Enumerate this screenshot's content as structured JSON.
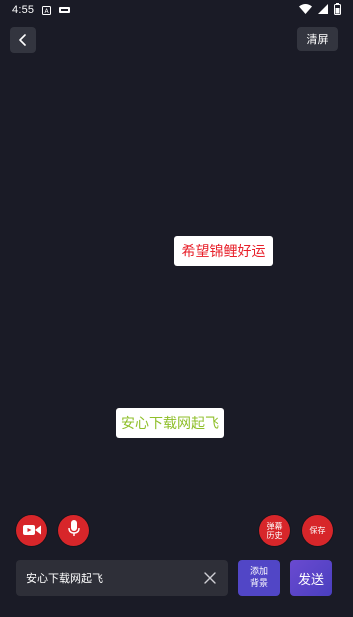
{
  "status": {
    "time": "4:55",
    "icons": [
      "a-box-icon",
      "media-icon",
      "wifi-icon",
      "signal-icon",
      "battery-icon"
    ]
  },
  "toolbar": {
    "back_icon": "chevron-left-icon",
    "clear_label": "清屏"
  },
  "danmaku": [
    {
      "text": "希望锦鲤好运",
      "color": "#e8202a"
    },
    {
      "text": "安心下载网起飞",
      "color": "#8fbf2a"
    }
  ],
  "controls": {
    "video_icon": "video-camera-icon",
    "mic_icon": "microphone-icon",
    "history_label": "弹幕历史",
    "save_label": "保存",
    "accent": "#d7262a"
  },
  "composer": {
    "input_value": "安心下载网起飞",
    "add_bg_label": "添加背景",
    "send_label": "发送"
  }
}
